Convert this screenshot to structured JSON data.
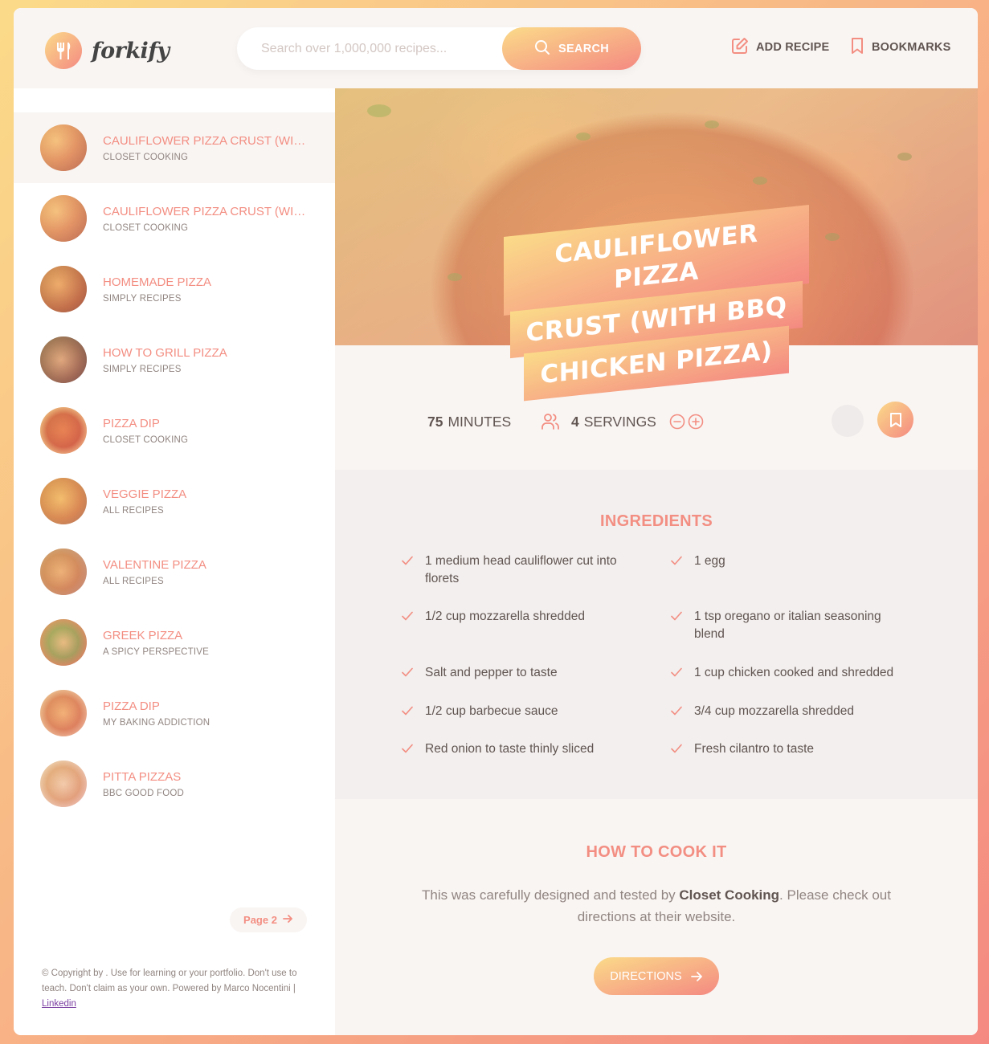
{
  "app": {
    "name": "forkify"
  },
  "search": {
    "placeholder": "Search over 1,000,000 recipes...",
    "button_label": "SEARCH"
  },
  "nav": {
    "add_recipe": "ADD RECIPE",
    "bookmarks": "BOOKMARKS"
  },
  "results": [
    {
      "title": "CAULIFLOWER PIZZA CRUST (WIT...",
      "publisher": "CLOSET COOKING",
      "active": true
    },
    {
      "title": "CAULIFLOWER PIZZA CRUST (WIT...",
      "publisher": "CLOSET COOKING",
      "active": false
    },
    {
      "title": "HOMEMADE PIZZA",
      "publisher": "SIMPLY RECIPES",
      "active": false
    },
    {
      "title": "HOW TO GRILL PIZZA",
      "publisher": "SIMPLY RECIPES",
      "active": false
    },
    {
      "title": "PIZZA DIP",
      "publisher": "CLOSET COOKING",
      "active": false
    },
    {
      "title": "VEGGIE PIZZA",
      "publisher": "ALL RECIPES",
      "active": false
    },
    {
      "title": "VALENTINE PIZZA",
      "publisher": "ALL RECIPES",
      "active": false
    },
    {
      "title": "GREEK PIZZA",
      "publisher": "A SPICY PERSPECTIVE",
      "active": false
    },
    {
      "title": "PIZZA DIP",
      "publisher": "MY BAKING ADDICTION",
      "active": false
    },
    {
      "title": "PITTA PIZZAS",
      "publisher": "BBC GOOD FOOD",
      "active": false
    }
  ],
  "pagination": {
    "next_label": "Page 2"
  },
  "copyright": {
    "text": "© Copyright by . Use for learning or your portfolio. Don't use to teach. Don't claim as your own. Powered by Marco Nocentini | ",
    "link": "Linkedin"
  },
  "recipe": {
    "title_lines": [
      "CAULIFLOWER PIZZA",
      "CRUST (WITH BBQ",
      "CHICKEN PIZZA)"
    ],
    "minutes": "75",
    "minutes_label": "MINUTES",
    "servings": "4",
    "servings_label": "SERVINGS",
    "ingredients_heading": "INGREDIENTS",
    "ingredients": [
      "1 medium head cauliflower cut into florets",
      "1 egg",
      "1/2 cup mozzarella shredded",
      "1 tsp oregano or italian seasoning blend",
      "Salt and pepper to taste",
      "1 cup chicken cooked and shredded",
      "1/2 cup barbecue sauce",
      "3/4 cup mozzarella shredded",
      "Red onion to taste thinly sliced",
      "Fresh cilantro to taste"
    ],
    "cook_heading": "HOW TO COOK IT",
    "cook_prefix": "This was carefully designed and tested by ",
    "publisher": "Closet Cooking",
    "cook_suffix": ". Please check out directions at their website.",
    "directions_label": "DIRECTIONS"
  },
  "colors": {
    "accent_start": "#fbdb89",
    "accent_end": "#f48982",
    "text": "#615551",
    "muted": "#918581",
    "bg": "#f9f5f3"
  },
  "icons": [
    "fork-knife-icon",
    "search-icon",
    "edit-icon",
    "bookmark-icon",
    "users-icon",
    "minus-circle-icon",
    "plus-circle-icon",
    "check-icon",
    "arrow-right-icon"
  ]
}
